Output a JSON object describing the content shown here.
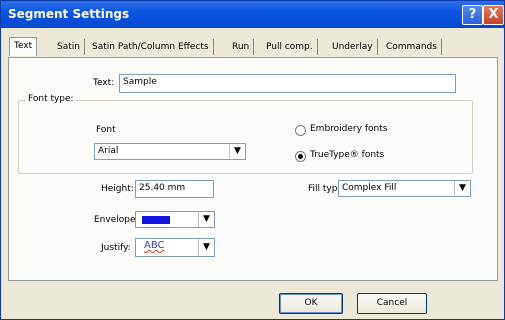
{
  "window": {
    "title": "Segment Settings",
    "help_glyph": "?",
    "close_glyph": "X"
  },
  "tabs": [
    {
      "label": "Text"
    },
    {
      "label": "Satin"
    },
    {
      "label": "Satin Path/Column Effects"
    },
    {
      "label": "Run"
    },
    {
      "label": "Pull comp."
    },
    {
      "label": "Underlay"
    },
    {
      "label": "Commands"
    }
  ],
  "text_field": {
    "label": "Text:",
    "value": "Sample"
  },
  "font_type": {
    "group_label": "Font type:",
    "font_label": "Font",
    "font_value": "Arial",
    "options": [
      {
        "label": "Embroidery fonts",
        "selected": false
      },
      {
        "label": "TrueType® fonts",
        "selected": true
      }
    ]
  },
  "height": {
    "label": "Height:",
    "value": "25.40 mm"
  },
  "fill_type": {
    "label": "Fill type:",
    "value": "Complex Fill"
  },
  "envelope": {
    "label": "Envelope:",
    "swatch_color": "#1414e0"
  },
  "justify": {
    "label": "Justify:",
    "preview": "ABC"
  },
  "buttons": {
    "ok": "OK",
    "cancel": "Cancel"
  },
  "icons": {
    "dropdown": "chevron-down-icon",
    "help": "help-icon",
    "close": "close-icon"
  }
}
